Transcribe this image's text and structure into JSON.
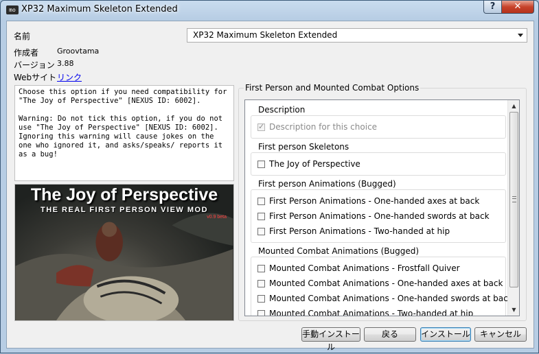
{
  "window": {
    "title": "XP32 Maximum Skeleton Extended",
    "app_icon_text": "mo",
    "help_glyph": "?",
    "close_glyph": "✕"
  },
  "info": {
    "name_label": "名前",
    "name_value": "XP32 Maximum Skeleton Extended",
    "author_label": "作成者",
    "author_value": "Groovtama",
    "version_label": "バージョン",
    "version_value": "3.88",
    "website_label": "Webサイト",
    "website_link": "リンク"
  },
  "description_text": "Choose this option if you need compatibility for \"The Joy of Perspective\" [NEXUS ID: 6002].\n\nWarning: Do not tick this option, if you do not use \"The Joy of Perspective\" [NEXUS ID: 6002]. Ignoring this warning will cause jokes on the one who ignored it, and asks/speaks/ reports it as a bug!",
  "preview": {
    "title": "The Joy of Perspective",
    "subtitle": "THE REAL FIRST PERSON VIEW MOD",
    "version": "v0.9 beta"
  },
  "options": {
    "group_title": "First Person and Mounted Combat Options",
    "sections": [
      {
        "title": "Description",
        "items": [
          {
            "label": "Description for this choice",
            "checked": true,
            "disabled": true
          }
        ]
      },
      {
        "title": "First person Skeletons",
        "items": [
          {
            "label": "The Joy of Perspective",
            "checked": false
          }
        ]
      },
      {
        "title": "First person Animations (Bugged)",
        "items": [
          {
            "label": "First Person Animations - One-handed axes at back",
            "checked": false
          },
          {
            "label": "First Person Animations - One-handed swords at back",
            "checked": false
          },
          {
            "label": "First Person Animations - Two-handed at hip",
            "checked": false
          }
        ]
      },
      {
        "title": "Mounted Combat Animations (Bugged)",
        "items": [
          {
            "label": "Mounted Combat Animations - Frostfall Quiver",
            "checked": false
          },
          {
            "label": "Mounted Combat Animations - One-handed axes at back",
            "checked": false
          },
          {
            "label": "Mounted Combat Animations - One-handed swords at back",
            "checked": false
          },
          {
            "label": "Mounted Combat Animations - Two-handed at hip",
            "checked": false
          }
        ]
      }
    ]
  },
  "buttons": {
    "manual_install": "手動インストール",
    "back": "戻る",
    "install": "インストール",
    "cancel": "キャンセル"
  },
  "colors": {
    "link": "#0000ee",
    "titlebar": "#b7cde4",
    "close_button": "#c7432b"
  }
}
